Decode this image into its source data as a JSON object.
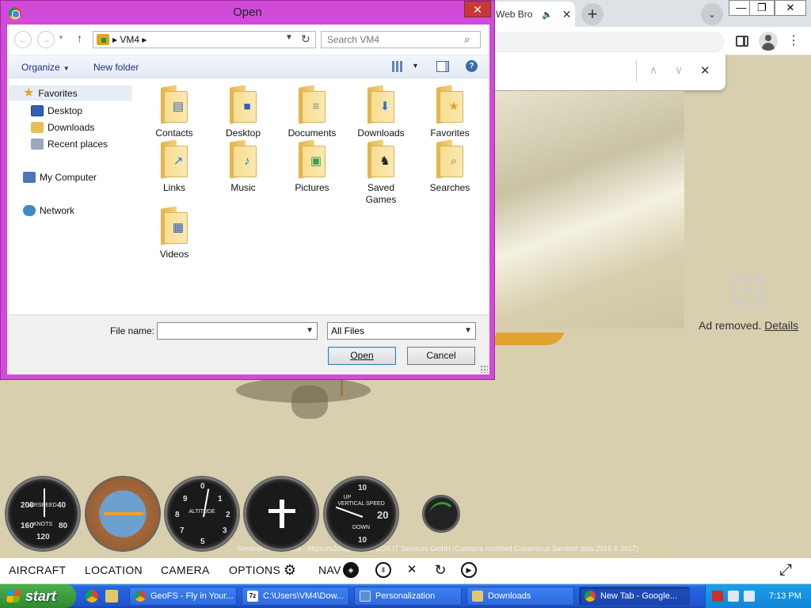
{
  "chrome": {
    "tab_title": "Web Bro",
    "speaker": "🔈",
    "tab_close": "✕",
    "new_tab": "+",
    "tab_list": "⌄",
    "minimize": "—",
    "restore": "❐",
    "close": "✕",
    "menu": "⋮",
    "find_up": "∧",
    "find_down": "∨",
    "find_close": "✕"
  },
  "dialog": {
    "title": "Open",
    "close": "✕",
    "back": "←",
    "forward": "→",
    "up": "↑",
    "address": "VM4",
    "search_placeholder": "Search VM4",
    "organize": "Organize",
    "new_folder": "New folder",
    "help": "?",
    "nav": {
      "favorites": "Favorites",
      "desktop": "Desktop",
      "downloads": "Downloads",
      "recent": "Recent places",
      "computer": "My Computer",
      "network": "Network"
    },
    "files": [
      "Contacts",
      "Desktop",
      "Documents",
      "Downloads",
      "Favorites",
      "Links",
      "Music",
      "Pictures",
      "Saved Games",
      "Searches",
      "Videos"
    ],
    "file_name_label": "File name:",
    "file_name_value": "",
    "filter": "All Files",
    "open_button": "Open",
    "cancel_button": "Cancel"
  },
  "game": {
    "copyright": "Sentinel-2 cloudless - https://s2maps.eu by EOX IT Services GmbH (Contains modified Copernicus Sentinel data 2016 & 2017)",
    "nav": {
      "aircraft": "AIRCRAFT",
      "location": "LOCATION",
      "camera": "CAMERA",
      "options": "OPTIONS",
      "nav": "NAV"
    },
    "icons": {
      "gear": "⚙",
      "compass": "◈",
      "pause": "Ⅱ",
      "mute": "✕",
      "reload": "↻",
      "play": "▶",
      "fullscreen": "⤢"
    },
    "airspeed_label": "AIRSPEED",
    "airspeed_unit": "KNOTS",
    "altimeter_label": "ALTITUDE",
    "vsi_label": "VERTICAL SPEED",
    "vsi_value": "20",
    "vsi_up": "UP",
    "vsi_down": "DOWN"
  },
  "ad": {
    "text": "Ad removed.",
    "details": "Details"
  },
  "taskbar": {
    "start": "start",
    "tasks": [
      "GeoFS - Fly in Your...",
      "C:\\Users\\VM4\\Dow...",
      "Personalization",
      "Downloads",
      "New Tab - Google..."
    ],
    "clock": "7:13 PM"
  },
  "colors": {
    "dialog_frame": "#d24ad9",
    "taskbar": "#235ede",
    "start_green": "#3c9e3c"
  }
}
